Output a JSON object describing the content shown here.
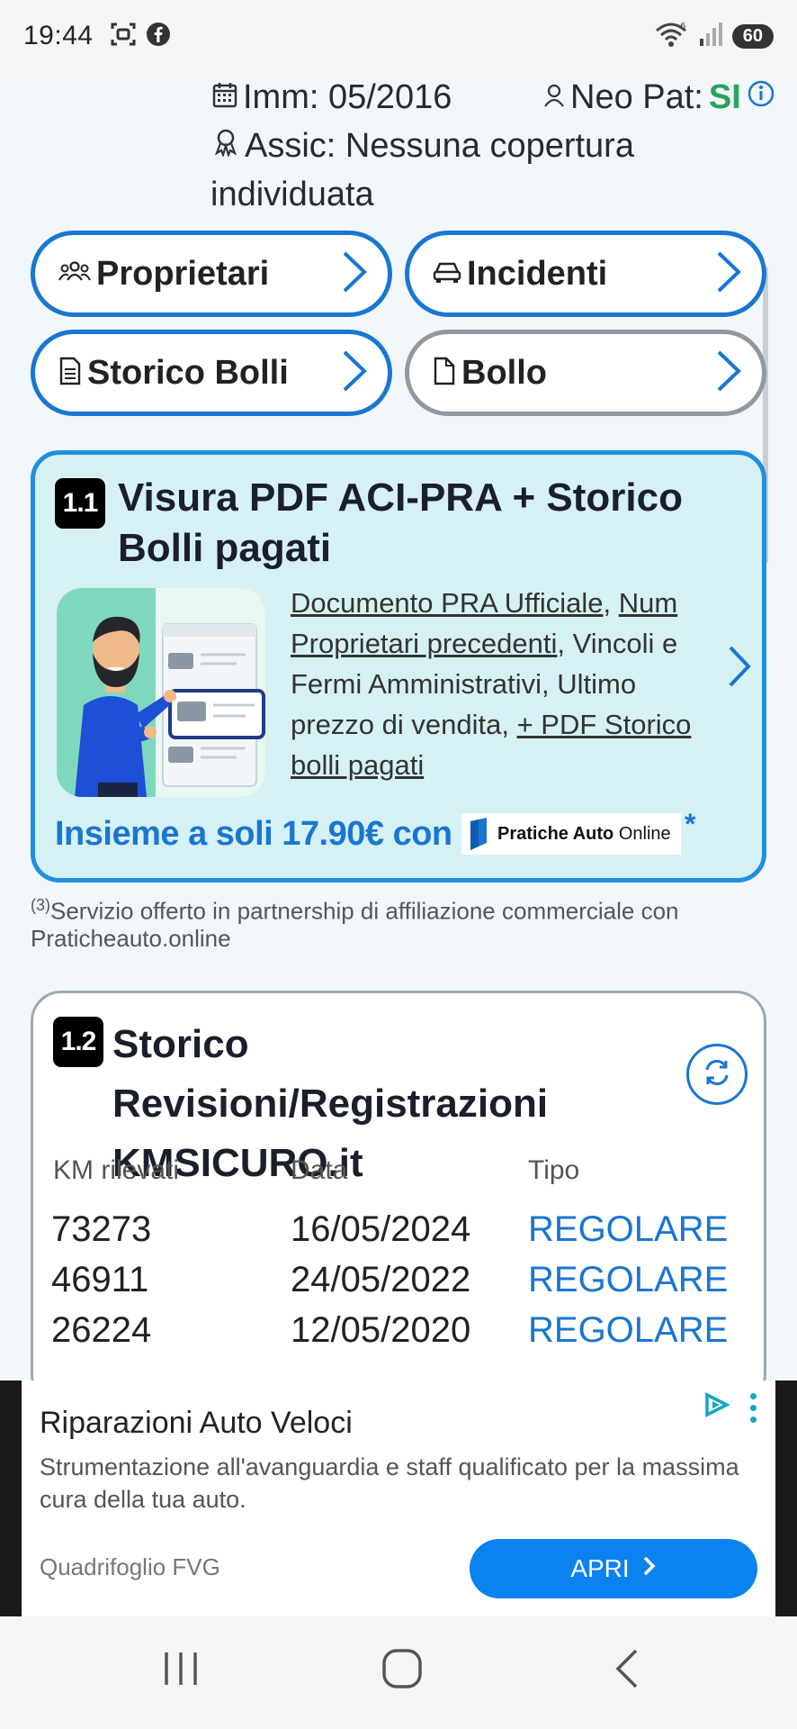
{
  "status_bar": {
    "time": "19:44",
    "battery": "60",
    "left_icons": [
      "screenshot-icon",
      "facebook-icon"
    ],
    "right_icons": [
      "wifi-icon",
      "signal-icon",
      "battery-icon"
    ]
  },
  "vehicle_info": {
    "registration": "Imm: 05/2016",
    "neo_pat_label": "Neo Pat:",
    "neo_pat_value": "SI",
    "insurance_line1": "Assic: Nessuna copertura",
    "insurance_line2": "individuata"
  },
  "buttons": {
    "owners": "Proprietari",
    "accidents": "Incidenti",
    "tax_history": "Storico Bolli",
    "tax": "Bollo"
  },
  "card_visura": {
    "badge": "1.1",
    "title_line1": "Visura PDF ACI-PRA + Storico",
    "title_line2": "Bolli pagati",
    "desc_link1": "Documento PRA Ufficiale",
    "desc_sep1": ", ",
    "desc_link2a": "Num",
    "desc_link2b": "Proprietari precedenti",
    "desc_text1": ", Vincoli e",
    "desc_text2": "Fermi Amministrativi, Ultimo",
    "desc_text3": "prezzo di vendita, ",
    "desc_link3a": "+ PDF Storico",
    "desc_link3b": "bolli pagati",
    "price": "Insieme a soli 17.90€ con",
    "partner_logo_text_bold": "Pratiche Auto",
    "partner_logo_text": " Online",
    "asterisk": "*"
  },
  "footnote": {
    "marker": "(3)",
    "text_line1": "Servizio offerto in partnership di affiliazione commerciale con",
    "text_line2": "Praticheauto.online"
  },
  "card_km": {
    "badge": "1.2",
    "title_line1": "Storico Revisioni/Registrazioni",
    "title_line2": "KMSICURO.it",
    "headers": [
      "KM rilevati",
      "Data",
      "Tipo"
    ],
    "rows": [
      {
        "km": "73273",
        "date": "16/05/2024",
        "type": "REGOLARE"
      },
      {
        "km": "46911",
        "date": "24/05/2022",
        "type": "REGOLARE"
      },
      {
        "km": "26224",
        "date": "12/05/2020",
        "type": "REGOLARE"
      }
    ]
  },
  "ad": {
    "title": "Riparazioni Auto Veloci",
    "text": "Strumentazione all'avanguardia e staff qualificato per la massima cura della tua auto.",
    "advertiser": "Quadrifoglio FVG",
    "cta": "APRI"
  },
  "colors": {
    "accent_blue": "#1976d2",
    "green": "#2aa35a",
    "card_bg": "#d6f1f4"
  }
}
